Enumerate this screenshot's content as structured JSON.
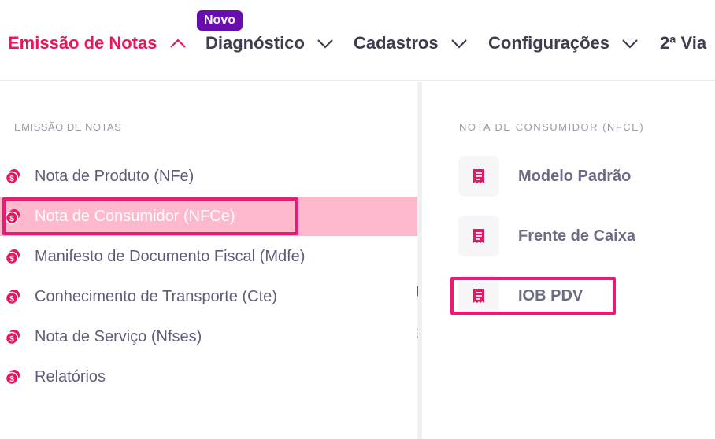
{
  "nav": {
    "items": [
      {
        "label": "Emissão de Notas",
        "active": true
      },
      {
        "label": "Diagnóstico",
        "active": false
      },
      {
        "label": "Cadastros",
        "active": false
      },
      {
        "label": "Configurações",
        "active": false
      },
      {
        "label": "2ª Via",
        "active": false
      }
    ],
    "badge": "Novo"
  },
  "left_menu": {
    "title": "EMISSÃO DE NOTAS",
    "items": [
      {
        "label": "Nota de Produto (NFe)",
        "icon": "coin-icon"
      },
      {
        "label": "Nota de Consumidor (NFCe)",
        "icon": "coin-icon",
        "selected": true
      },
      {
        "label": "Manifesto de Documento Fiscal (Mdfe)",
        "icon": "coin-icon"
      },
      {
        "label": "Conhecimento de Transporte (Cte)",
        "icon": "coin-icon"
      },
      {
        "label": "Nota de Serviço (Nfses)",
        "icon": "coin-icon"
      },
      {
        "label": "Relatórios",
        "icon": "coin-icon"
      }
    ]
  },
  "right_menu": {
    "title": "NOTA DE CONSUMIDOR (NFCE)",
    "items": [
      {
        "label": "Modelo Padrão",
        "icon": "receipt-icon"
      },
      {
        "label": "Frente de Caixa",
        "icon": "receipt-icon"
      },
      {
        "label": "IOB PDV",
        "icon": "receipt-icon",
        "highlighted": true
      }
    ]
  },
  "colors": {
    "accent": "#e8175d",
    "highlight_border": "#ee1877",
    "selected_bg": "#ffb9cd",
    "badge_bg": "#6a0dad"
  }
}
